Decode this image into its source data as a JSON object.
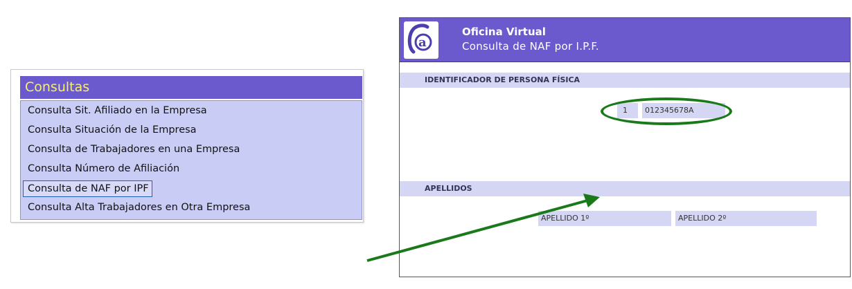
{
  "menu": {
    "title": "Consultas",
    "items": [
      {
        "label": "Consulta Sit. Afiliado en la Empresa"
      },
      {
        "label": "Consulta Situación de la Empresa"
      },
      {
        "label": "Consulta de Trabajadores en una Empresa"
      },
      {
        "label": "Consulta Número de Afiliación"
      },
      {
        "label": "Consulta de NAF por IPF",
        "selected": true
      },
      {
        "label": "Consulta Alta Trabajadores en Otra Empresa"
      }
    ]
  },
  "panel": {
    "logo_icon": "at-sign-icon",
    "app_title": "Oficina Virtual",
    "subtitle": "Consulta  de  NAF  por  I.P.F.",
    "section_ipf": "IDENTIFICADOR DE PERSONA FÍSICA",
    "ipf_type": "1",
    "ipf_number": "012345678A",
    "section_apellidos": "APELLIDOS",
    "apellido1_label": "APELLIDO 1º",
    "apellido2_label": "APELLIDO 2º"
  },
  "colors": {
    "header_purple": "#6a5acd",
    "menu_title_yellow": "#f7f06a",
    "list_background": "#c9cdf6",
    "annotation_green": "#1a7a1a"
  }
}
